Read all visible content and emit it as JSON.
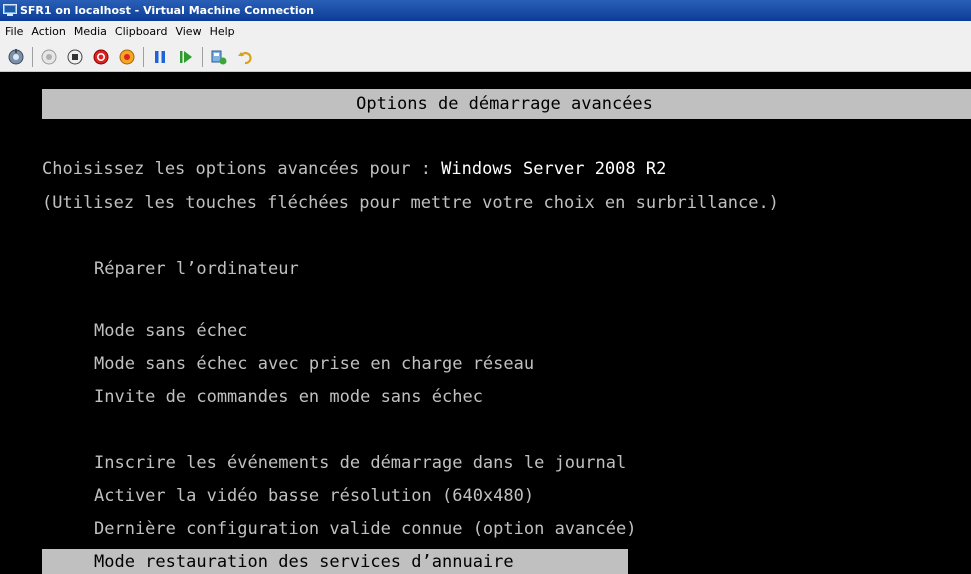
{
  "window": {
    "title": "SFR1 on localhost - Virtual Machine Connection"
  },
  "menu": {
    "items": [
      "File",
      "Action",
      "Media",
      "Clipboard",
      "View",
      "Help"
    ]
  },
  "toolbar": {
    "buttons": [
      {
        "name": "ctrl-alt-del-icon"
      },
      {
        "name": "start-icon"
      },
      {
        "name": "turn-off-icon"
      },
      {
        "name": "shut-down-icon"
      },
      {
        "name": "power-icon"
      },
      {
        "name": "pause-icon"
      },
      {
        "name": "resume-icon"
      },
      {
        "name": "snapshot-icon"
      },
      {
        "name": "revert-icon"
      }
    ]
  },
  "boot_menu": {
    "header": "Options de démarrage avancées",
    "prompt_prefix": "Choisissez les options avancées pour : ",
    "os_name": "Windows Server 2008 R2",
    "hint": "(Utilisez les touches fléchées pour mettre votre choix en surbrillance.)",
    "options": [
      "Réparer l’ordinateur",
      "Mode sans échec",
      "Mode sans échec avec prise en charge réseau",
      "Invite de commandes en mode sans échec",
      "Inscrire les événements de démarrage dans le journal",
      "Activer la vidéo basse résolution (640x480)",
      "Dernière configuration valide connue (option avancée)",
      "Mode restauration des services d’annuaire"
    ],
    "selected_index": 7
  },
  "colors": {
    "titlebar": "#0b3d96",
    "console_bg": "#000000",
    "console_fg": "#c0c0c0",
    "highlight_bg": "#c0c0c0",
    "highlight_fg": "#000000"
  }
}
